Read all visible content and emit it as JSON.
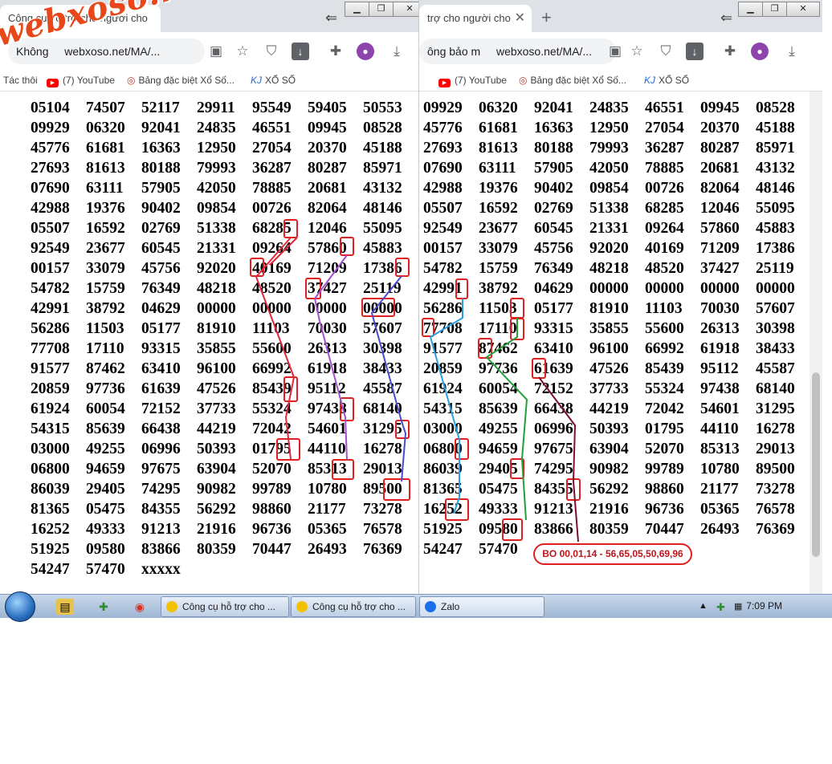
{
  "watermark": "webxoso.net",
  "left_window": {
    "tab_title": "Công cụ hỗ trợ cho người cho",
    "url_prefix": "Không",
    "url": "webxoso.net/MA/...",
    "bookmarks": [
      "Tác thôi",
      "(7) YouTube",
      "Bảng đặc biệt Xổ Số...",
      "XỔ SỐ"
    ]
  },
  "right_window": {
    "tab_title": "trợ cho người cho",
    "url_prefix": "ông bảo m",
    "url": "webxoso.net/MA/...",
    "bookmarks": [
      "(7) YouTube",
      "Bảng đặc biệt Xổ Số...",
      "XỔ SỐ"
    ]
  },
  "left_grid": [
    [
      "05104",
      "74507",
      "52117",
      "29911",
      "95549",
      "59405",
      "50553"
    ],
    [
      "09929",
      "06320",
      "92041",
      "24835",
      "46551",
      "09945",
      "08528"
    ],
    [
      "45776",
      "61681",
      "16363",
      "12950",
      "27054",
      "20370",
      "45188"
    ],
    [
      "27693",
      "81613",
      "80188",
      "79993",
      "36287",
      "80287",
      "85971"
    ],
    [
      "07690",
      "63111",
      "57905",
      "42050",
      "78885",
      "20681",
      "43132"
    ],
    [
      "42988",
      "19376",
      "90402",
      "09854",
      "00726",
      "82064",
      "48146"
    ],
    [
      "05507",
      "16592",
      "02769",
      "51338",
      "68285",
      "12046",
      "55095"
    ],
    [
      "92549",
      "23677",
      "60545",
      "21331",
      "09264",
      "57860",
      "45883"
    ],
    [
      "00157",
      "33079",
      "45756",
      "92020",
      "40169",
      "71209",
      "17386"
    ],
    [
      "54782",
      "15759",
      "76349",
      "48218",
      "48520",
      "37427",
      "25119"
    ],
    [
      "42991",
      "38792",
      "04629",
      "00000",
      "00000",
      "00000",
      "00000"
    ],
    [
      "56286",
      "11503",
      "05177",
      "81910",
      "11103",
      "70030",
      "57607"
    ],
    [
      "77708",
      "17110",
      "93315",
      "35855",
      "55600",
      "26313",
      "30398"
    ],
    [
      "91577",
      "87462",
      "63410",
      "96100",
      "66992",
      "61918",
      "38433"
    ],
    [
      "20859",
      "97736",
      "61639",
      "47526",
      "85439",
      "95112",
      "45587"
    ],
    [
      "61924",
      "60054",
      "72152",
      "37733",
      "55324",
      "97438",
      "68140"
    ],
    [
      "54315",
      "85639",
      "66438",
      "44219",
      "72042",
      "54601",
      "31295"
    ],
    [
      "03000",
      "49255",
      "06996",
      "50393",
      "01795",
      "44110",
      "16278"
    ],
    [
      "06800",
      "94659",
      "97675",
      "63904",
      "52070",
      "85313",
      "29013"
    ],
    [
      "86039",
      "29405",
      "74295",
      "90982",
      "99789",
      "10780",
      "89500"
    ],
    [
      "81365",
      "05475",
      "84355",
      "56292",
      "98860",
      "21177",
      "73278"
    ],
    [
      "16252",
      "49333",
      "91213",
      "21916",
      "96736",
      "05365",
      "76578"
    ],
    [
      "51925",
      "09580",
      "83866",
      "80359",
      "70447",
      "26493",
      "76369"
    ],
    [
      "54247",
      "57470",
      "xxxxx"
    ]
  ],
  "right_grid": [
    [
      "09929",
      "06320",
      "92041",
      "24835",
      "46551",
      "09945",
      "08528"
    ],
    [
      "45776",
      "61681",
      "16363",
      "12950",
      "27054",
      "20370",
      "45188"
    ],
    [
      "27693",
      "81613",
      "80188",
      "79993",
      "36287",
      "80287",
      "85971"
    ],
    [
      "07690",
      "63111",
      "57905",
      "42050",
      "78885",
      "20681",
      "43132"
    ],
    [
      "42988",
      "19376",
      "90402",
      "09854",
      "00726",
      "82064",
      "48146"
    ],
    [
      "05507",
      "16592",
      "02769",
      "51338",
      "68285",
      "12046",
      "55095"
    ],
    [
      "92549",
      "23677",
      "60545",
      "21331",
      "09264",
      "57860",
      "45883"
    ],
    [
      "00157",
      "33079",
      "45756",
      "92020",
      "40169",
      "71209",
      "17386"
    ],
    [
      "54782",
      "15759",
      "76349",
      "48218",
      "48520",
      "37427",
      "25119"
    ],
    [
      "42991",
      "38792",
      "04629",
      "00000",
      "00000",
      "00000",
      "00000"
    ],
    [
      "56286",
      "11503",
      "05177",
      "81910",
      "11103",
      "70030",
      "57607"
    ],
    [
      "77708",
      "17110",
      "93315",
      "35855",
      "55600",
      "26313",
      "30398"
    ],
    [
      "91577",
      "87462",
      "63410",
      "96100",
      "66992",
      "61918",
      "38433"
    ],
    [
      "20859",
      "97736",
      "61639",
      "47526",
      "85439",
      "95112",
      "45587"
    ],
    [
      "61924",
      "60054",
      "72152",
      "37733",
      "55324",
      "97438",
      "68140"
    ],
    [
      "54315",
      "85639",
      "66438",
      "44219",
      "72042",
      "54601",
      "31295"
    ],
    [
      "03000",
      "49255",
      "06996",
      "50393",
      "01795",
      "44110",
      "16278"
    ],
    [
      "06800",
      "94659",
      "97675",
      "63904",
      "52070",
      "85313",
      "29013"
    ],
    [
      "86039",
      "29405",
      "74295",
      "90982",
      "99789",
      "10780",
      "89500"
    ],
    [
      "81365",
      "05475",
      "84355",
      "56292",
      "98860",
      "21177",
      "73278"
    ],
    [
      "16252",
      "49333",
      "91213",
      "21916",
      "96736",
      "05365",
      "76578"
    ],
    [
      "51925",
      "09580",
      "83866",
      "80359",
      "70447",
      "26493",
      "76369"
    ],
    [
      "54247",
      "57470"
    ]
  ],
  "annotation_label": "BO 00,01,14 - 56,65,05,50,69,96",
  "annotation_colors": {
    "box": "#e02020",
    "line_red": "#e0283a",
    "line_purple": "#a64fcf",
    "line_blue": "#4a4ad0",
    "line_cyan": "#2aa0e0",
    "line_green": "#22a03a",
    "line_maroon": "#7a1030"
  },
  "taskbar": {
    "tasks": [
      "Công cụ hỗ trợ cho ...",
      "Công cụ hỗ trợ cho ...",
      "Zalo"
    ],
    "clock": "7:09 PM"
  }
}
